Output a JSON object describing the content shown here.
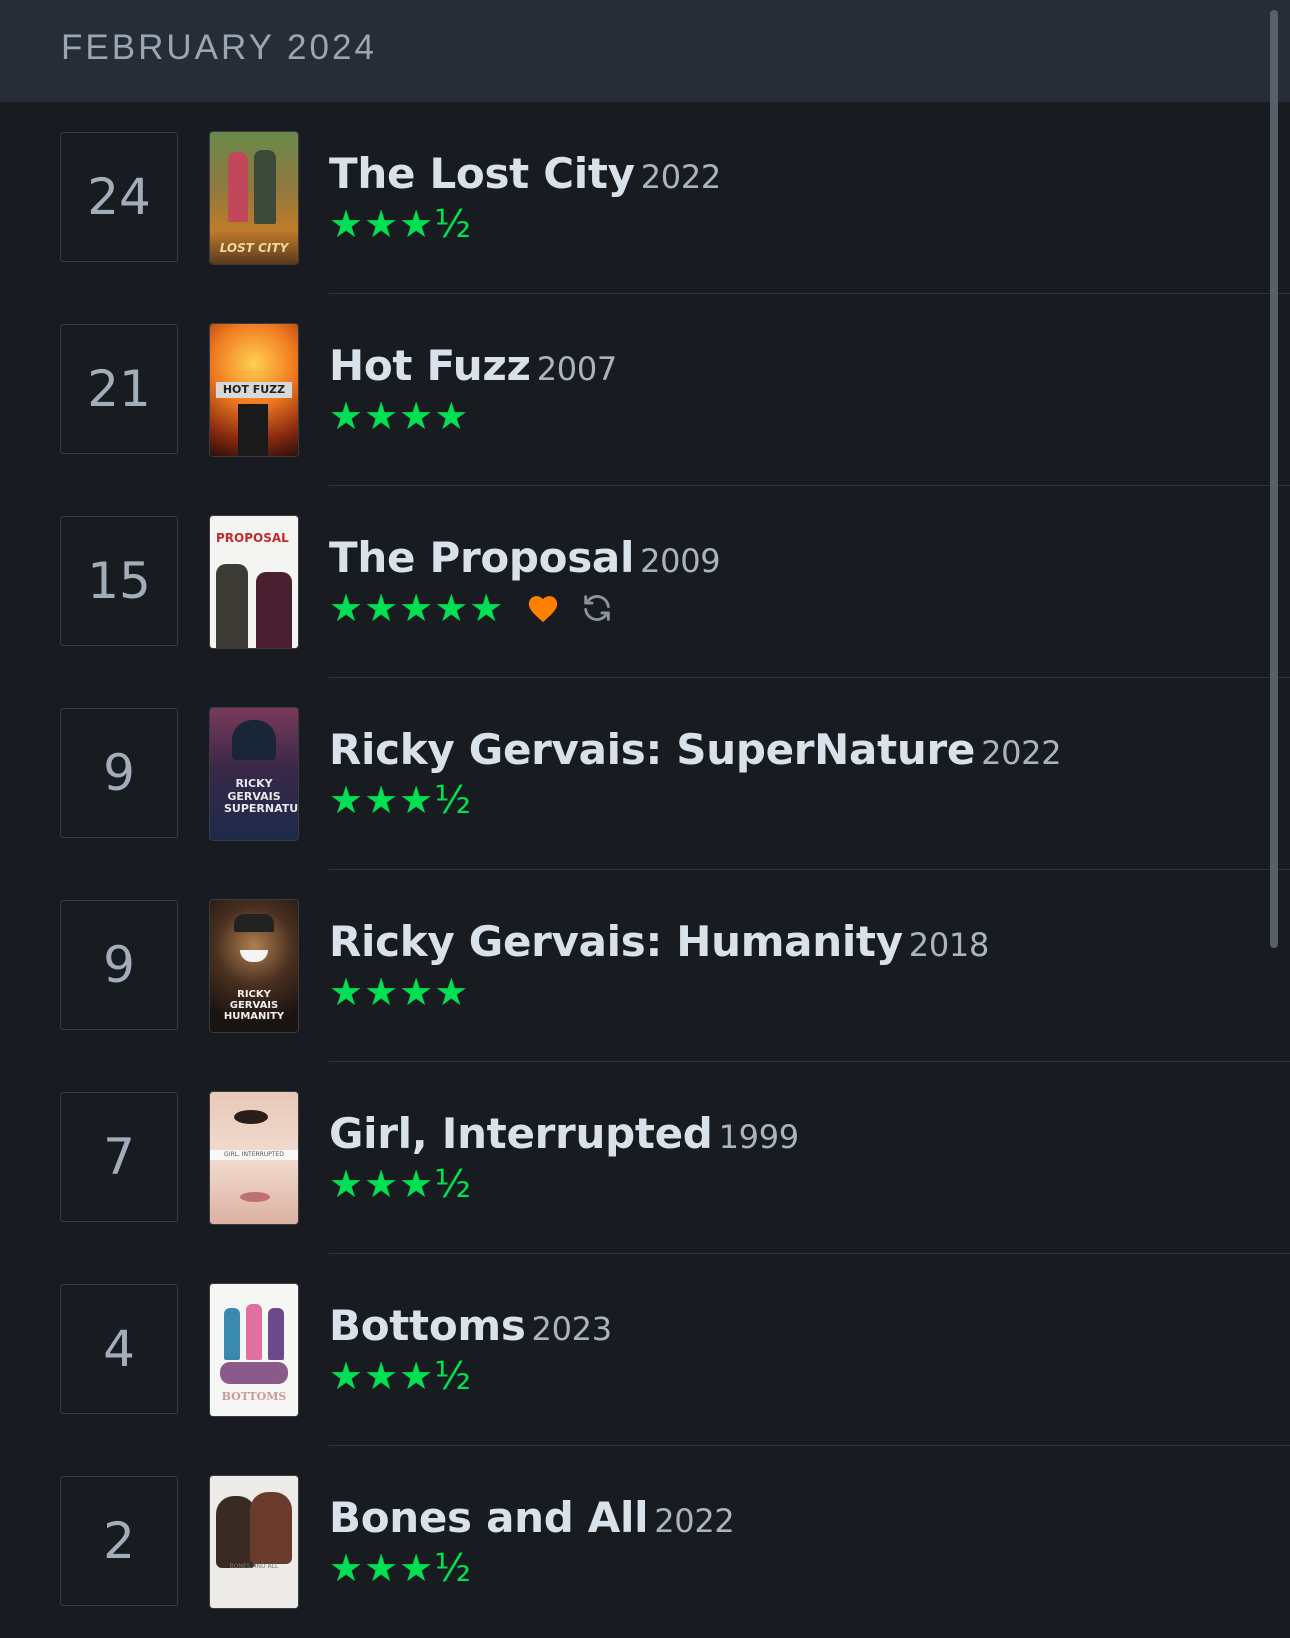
{
  "header": {
    "month_label": "FEBRUARY 2024"
  },
  "colors": {
    "star": "#00e054",
    "like": "#ff8000",
    "rewatch": "#8a94a0",
    "background": "#181b20",
    "header_bg": "#272d36"
  },
  "entries": [
    {
      "day": "24",
      "title": "The Lost City",
      "year": "2022",
      "rating": "★★★½",
      "rating_value": 3.5,
      "liked": false,
      "rewatch": false,
      "poster_text": "LOST CITY",
      "poster_icon": "poster-the-lost-city"
    },
    {
      "day": "21",
      "title": "Hot Fuzz",
      "year": "2007",
      "rating": "★★★★",
      "rating_value": 4,
      "liked": false,
      "rewatch": false,
      "poster_text": "HOT FUZZ",
      "poster_icon": "poster-hot-fuzz"
    },
    {
      "day": "15",
      "title": "The Proposal",
      "year": "2009",
      "rating": "★★★★★",
      "rating_value": 5,
      "liked": true,
      "rewatch": true,
      "poster_text": "PROPOSAL",
      "poster_icon": "poster-the-proposal"
    },
    {
      "day": "9",
      "title": "Ricky Gervais: SuperNature",
      "year": "2022",
      "rating": "★★★½",
      "rating_value": 3.5,
      "liked": false,
      "rewatch": false,
      "poster_text": "RICKY GERVAIS SUPERNATURE",
      "poster_icon": "poster-supernature"
    },
    {
      "day": "9",
      "title": "Ricky Gervais: Humanity",
      "year": "2018",
      "rating": "★★★★",
      "rating_value": 4,
      "liked": false,
      "rewatch": false,
      "poster_text": "RICKY GERVAIS HUMANITY",
      "poster_icon": "poster-humanity"
    },
    {
      "day": "7",
      "title": "Girl, Interrupted",
      "year": "1999",
      "rating": "★★★½",
      "rating_value": 3.5,
      "liked": false,
      "rewatch": false,
      "poster_text": "GIRL, INTERRUPTED",
      "poster_icon": "poster-girl-interrupted"
    },
    {
      "day": "4",
      "title": "Bottoms",
      "year": "2023",
      "rating": "★★★½",
      "rating_value": 3.5,
      "liked": false,
      "rewatch": false,
      "poster_text": "BOTTOMS",
      "poster_icon": "poster-bottoms"
    },
    {
      "day": "2",
      "title": "Bones and All",
      "year": "2022",
      "rating": "★★★½",
      "rating_value": 3.5,
      "liked": false,
      "rewatch": false,
      "poster_text": "BONES AND ALL",
      "poster_icon": "poster-bones-and-all"
    }
  ]
}
